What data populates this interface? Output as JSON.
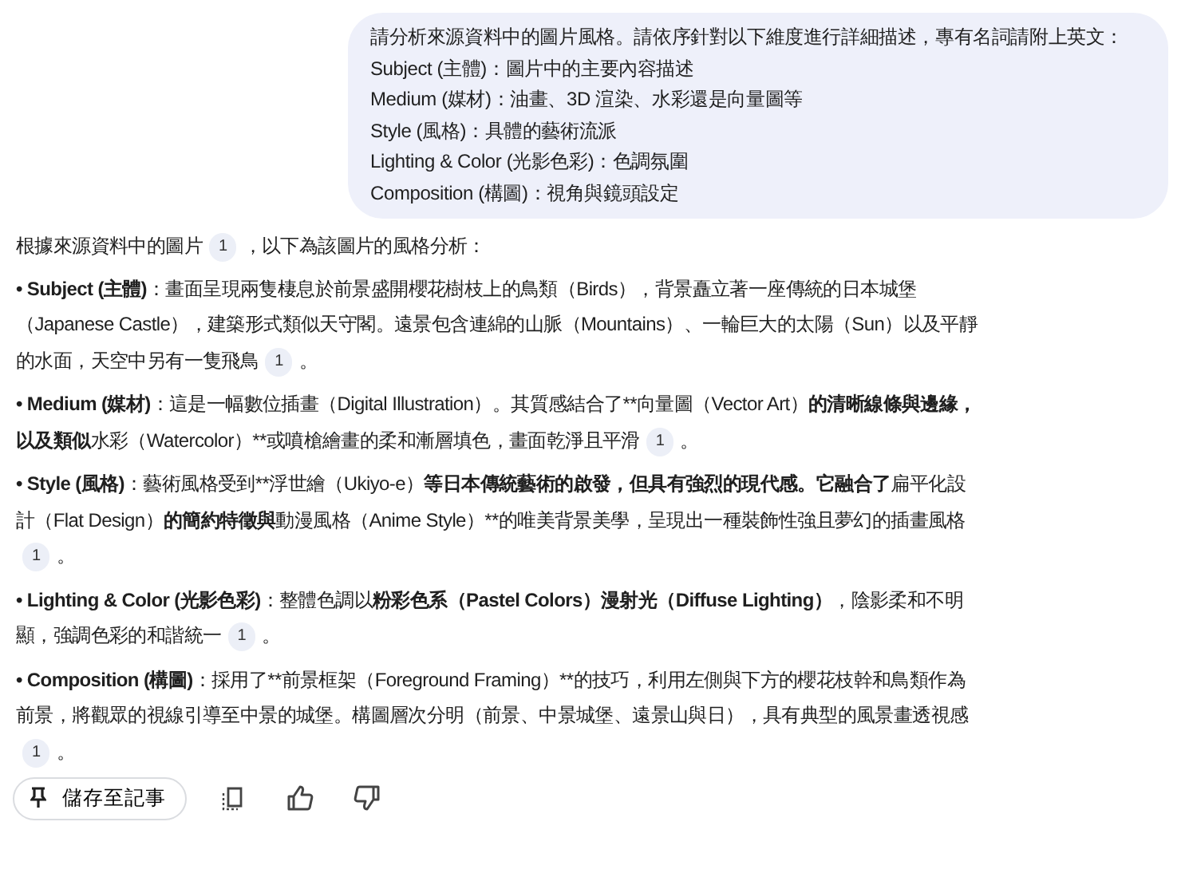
{
  "user_message": {
    "lines": [
      "請分析來源資料中的圖片風格。請依序針對以下維度進行詳細描述，專有名詞請附上英文：",
      "Subject (主體)：圖片中的主要內容描述",
      "Medium (媒材)：油畫、3D 渲染、水彩還是向量圖等",
      "Style (風格)：具體的藝術流派",
      "Lighting & Color (光影色彩)：色調氛圍",
      "Composition (構圖)：視角與鏡頭設定"
    ]
  },
  "response": {
    "paragraphs": [
      {
        "kind": "intro",
        "segments": [
          {
            "text": "根據來源資料中的圖片",
            "bold": false
          },
          {
            "citation": "1"
          },
          {
            "text": "，以下為該圖片的風格分析：",
            "bold": false
          }
        ]
      },
      {
        "kind": "bullet",
        "segments": [
          {
            "text": "• Subject (主體)",
            "bold": true
          },
          {
            "text": "：畫面呈現兩隻棲息於前景盛開櫻花樹枝上的鳥類（Birds），背景矗立著一座傳統的日本城堡（Japanese Castle），建築形式類似天守閣。遠景包含連綿的山脈（Mountains）、一輪巨大的太陽（Sun）以及平靜的水面，天空中另有一隻飛鳥",
            "bold": false
          },
          {
            "citation": "1"
          },
          {
            "text": "。",
            "bold": false
          }
        ]
      },
      {
        "kind": "bullet",
        "segments": [
          {
            "text": "• Medium (媒材)",
            "bold": true
          },
          {
            "text": "：這是一幅數位插畫（Digital Illustration）。其質感結合了**向量圖（Vector Art）",
            "bold": false
          },
          {
            "text": "的清晰線條與邊緣，以及類似",
            "bold": true
          },
          {
            "text": "水彩（Watercolor）**或噴槍繪畫的柔和漸層填色，畫面乾淨且平滑",
            "bold": false
          },
          {
            "citation": "1"
          },
          {
            "text": "。",
            "bold": false
          }
        ]
      },
      {
        "kind": "bullet",
        "segments": [
          {
            "text": "• Style (風格)",
            "bold": true
          },
          {
            "text": "：藝術風格受到**浮世繪（Ukiyo-e）",
            "bold": false
          },
          {
            "text": "等日本傳統藝術的啟發，但具有強烈的現代感。它融合了",
            "bold": true
          },
          {
            "text": "扁平化設計（Flat Design）",
            "bold": false
          },
          {
            "text": "的簡約特徵與",
            "bold": true
          },
          {
            "text": "動漫風格（Anime Style）**的唯美背景美學，呈現出一種裝飾性強且夢幻的插畫風格",
            "bold": false
          },
          {
            "citation": "1"
          },
          {
            "text": "。",
            "bold": false
          }
        ]
      },
      {
        "kind": "bullet",
        "segments": [
          {
            "text": "• Lighting & Color (光影色彩)",
            "bold": true
          },
          {
            "text": "：整體色調以",
            "bold": false
          },
          {
            "text": "粉彩色系（Pastel Colors）漫射光（Diffuse Lighting）",
            "bold": true
          },
          {
            "text": "，陰影柔和不明顯，強調色彩的和諧統一",
            "bold": false
          },
          {
            "citation": "1"
          },
          {
            "text": "。",
            "bold": false
          }
        ]
      },
      {
        "kind": "bullet",
        "segments": [
          {
            "text": "• Composition (構圖)",
            "bold": true
          },
          {
            "text": "：採用了**前景框架（Foreground Framing）**的技巧，利用左側與下方的櫻花枝幹和鳥類作為前景，將觀眾的視線引導至中景的城堡。構圖層次分明（前景、中景城堡、遠景山與日），具有典型的風景畫透視感",
            "bold": false
          },
          {
            "citation": "1"
          },
          {
            "text": "。",
            "bold": false
          }
        ]
      }
    ]
  },
  "toolbar": {
    "save_button": "儲存至記事"
  }
}
